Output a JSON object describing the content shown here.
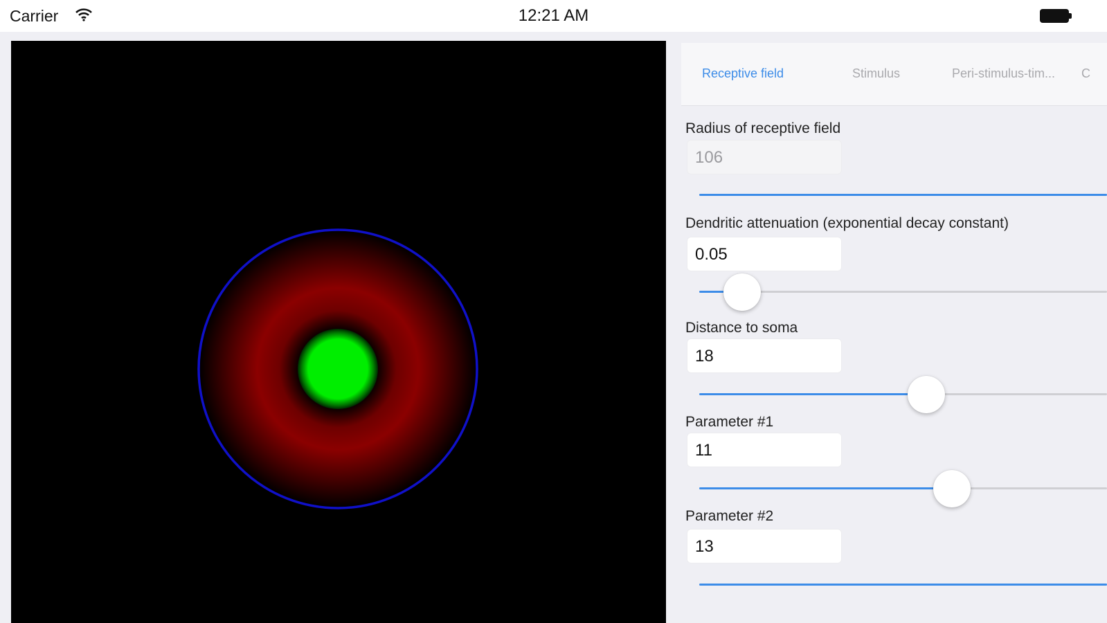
{
  "status_bar": {
    "carrier": "Carrier",
    "time": "12:21 AM",
    "icons": [
      "wifi-icon",
      "battery-icon"
    ]
  },
  "stage": {
    "background": "#000000",
    "outer_ring_color": "#1010c8",
    "surround_color": "#8b0000",
    "center_color": "#00ee00"
  },
  "tabs": [
    {
      "label": "Receptive field",
      "active": true
    },
    {
      "label": "Stimulus",
      "active": false
    },
    {
      "label": "Peri-stimulus-tim...",
      "active": false
    },
    {
      "label": "C",
      "active": false
    }
  ],
  "controls": [
    {
      "label": "Radius of receptive field",
      "value": "106",
      "enabled": false,
      "slider_fraction": 1.0
    },
    {
      "label": "Dendritic attenuation (exponential decay constant)",
      "value": "0.05",
      "enabled": true,
      "slider_fraction": 0.105
    },
    {
      "label": "Distance to soma",
      "value": "18",
      "enabled": true,
      "slider_fraction": 0.557
    },
    {
      "label": "Parameter #1",
      "value": "11",
      "enabled": true,
      "slider_fraction": 0.62
    },
    {
      "label": "Parameter #2",
      "value": "13",
      "enabled": true,
      "slider_fraction": 1.0
    }
  ],
  "colors": {
    "accent": "#3c8ce8",
    "inactive_tab": "#a9a9ad",
    "panel_background": "#efeff4"
  }
}
